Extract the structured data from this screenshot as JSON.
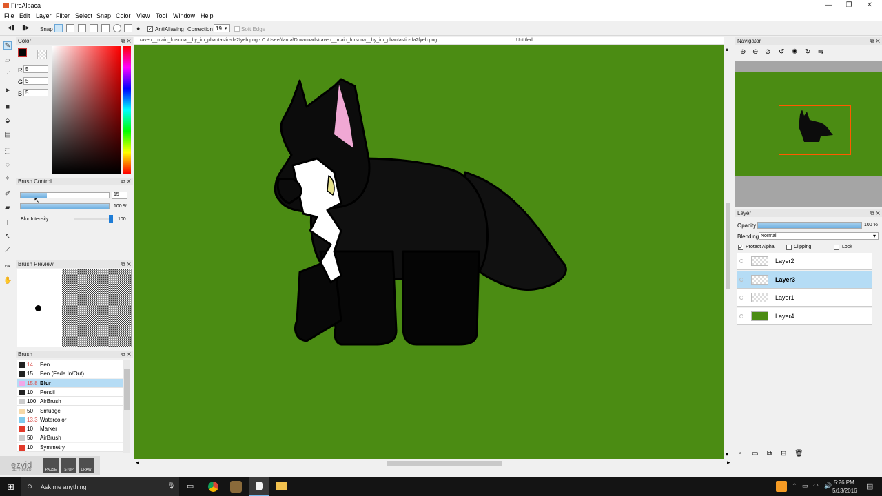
{
  "window": {
    "title": "FireAlpaca"
  },
  "menu": [
    "File",
    "Edit",
    "Layer",
    "Filter",
    "Select",
    "Snap",
    "Color",
    "View",
    "Tool",
    "Window",
    "Help"
  ],
  "toolbar": {
    "snap_label": "Snap",
    "antialiasing_label": "AntiAliasing",
    "antialiasing_checked": true,
    "correction_label": "Correction",
    "correction_value": "19",
    "soft_edge_label": "Soft Edge"
  },
  "tabs": {
    "file_tab": "raven__main_fursona__by_im_phantastic-da2fyeb.png - C:\\Users\\laura\\Downloads\\raven__main_fursona__by_im_phantastic-da2fyeb.png",
    "untitled_tab": "Untitled"
  },
  "color_panel": {
    "title": "Color",
    "r_label": "R",
    "r_value": "5",
    "g_label": "G",
    "g_value": "5",
    "b_label": "B",
    "b_value": "5",
    "foreground": "#050505"
  },
  "brush_control": {
    "title": "Brush Control",
    "size_value": "15",
    "opacity_value": "100 %",
    "size_fraction": 0.3,
    "opacity_fraction": 1.0,
    "blur_label": "Blur Intensity",
    "blur_value": "100",
    "blur_fraction": 1.0
  },
  "brush_preview": {
    "title": "Brush Preview"
  },
  "brush_panel": {
    "title": "Brush",
    "items": [
      {
        "num": "14",
        "name": "Pen",
        "color": "#222222",
        "selected": false,
        "num_color": "#d9534f"
      },
      {
        "num": "15",
        "name": "Pen (Fade In/Out)",
        "color": "#222222",
        "selected": false,
        "num_color": "#000000"
      },
      {
        "num": "15.8",
        "name": "Blur",
        "color": "#f0a8e8",
        "selected": true,
        "num_color": "#d9534f"
      },
      {
        "num": "10",
        "name": "Pencil",
        "color": "#222222",
        "selected": false,
        "num_color": "#000000"
      },
      {
        "num": "100",
        "name": "AirBrush",
        "color": "#cccccc",
        "selected": false,
        "num_color": "#000000"
      },
      {
        "num": "50",
        "name": "Smudge",
        "color": "#f5d9a8",
        "selected": false,
        "num_color": "#000000"
      },
      {
        "num": "13.3",
        "name": "Watercolor",
        "color": "#7ecbee",
        "selected": false,
        "num_color": "#d9534f"
      },
      {
        "num": "10",
        "name": "Marker",
        "color": "#e23a2a",
        "selected": false,
        "num_color": "#000000"
      },
      {
        "num": "50",
        "name": "AirBrush",
        "color": "#cccccc",
        "selected": false,
        "num_color": "#000000"
      },
      {
        "num": "10",
        "name": "Symmetry",
        "color": "#e23a2a",
        "selected": false,
        "num_color": "#000000"
      }
    ]
  },
  "navigator": {
    "title": "Navigator"
  },
  "layer_panel": {
    "title": "Layer",
    "opacity_label": "Opacity",
    "opacity_value": "100 %",
    "blending_label": "Blending",
    "blending_value": "Normal",
    "protect_alpha_label": "Protect Alpha",
    "protect_alpha_checked": true,
    "clipping_label": "Clipping",
    "lock_label": "Lock",
    "layers": [
      {
        "name": "Layer2",
        "selected": false
      },
      {
        "name": "Layer3",
        "selected": true
      },
      {
        "name": "Layer1",
        "selected": false
      },
      {
        "name": "Layer4",
        "selected": false
      }
    ]
  },
  "recorder": {
    "logo": "ezvid",
    "sub": "RECORDER",
    "pause": "PAUSE",
    "stop": "STOP",
    "draw": "DRAW"
  },
  "taskbar": {
    "search_placeholder": "Ask me anything",
    "time": "5:26 PM",
    "date": "5/13/2016"
  },
  "colors": {
    "canvas_bg": "#4b8c13",
    "selection": "#b5dcf5",
    "accent": "#e05a2a"
  }
}
